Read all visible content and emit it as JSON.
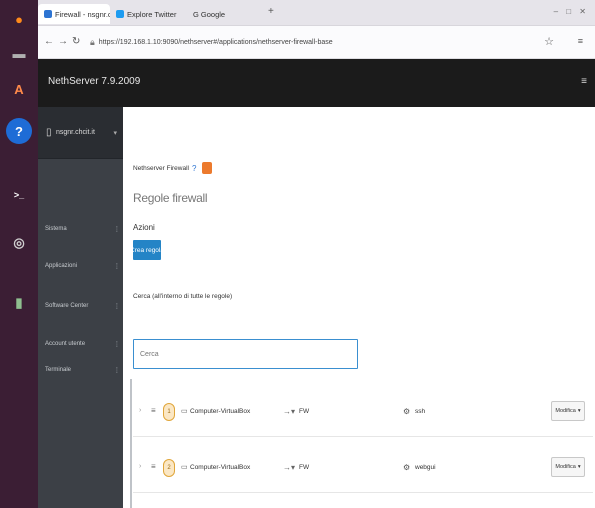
{
  "dock": {
    "items": [
      {
        "name": "firefox-icon",
        "glyph": "●",
        "color": "#e66000"
      },
      {
        "name": "files-icon",
        "glyph": "▬",
        "color": "#8a8a8a"
      },
      {
        "name": "software-icon",
        "glyph": "A",
        "color": "#e95420"
      },
      {
        "name": "help-icon",
        "glyph": "?",
        "color": "#1e6cd6"
      },
      {
        "name": "terminal-icon",
        "glyph": ">_",
        "color": "#333333"
      },
      {
        "name": "disc-icon",
        "glyph": "◎",
        "color": "#777777"
      },
      {
        "name": "trash-icon",
        "glyph": "▮",
        "color": "#5a8a5a"
      }
    ]
  },
  "browser": {
    "tabs": [
      {
        "label": "Firewall - nsgnr.chcit",
        "active": true
      },
      {
        "label": "Explore Twitter",
        "active": false
      },
      {
        "label": "G Google",
        "active": false
      }
    ],
    "new_tab": "+",
    "window_controls": "‒ □ ✕",
    "nav": {
      "back": "←",
      "forward": "→",
      "reload": "↻"
    },
    "url": "https://192.168.1.10:9090/nethserver#/applications/nethserver-firewall-base",
    "bookmark": "☆",
    "menu": "≡"
  },
  "app": {
    "title": "NethServer 7.9.2009",
    "header_icon": "≡"
  },
  "sidebar": {
    "host_label": "nsgnr.chcit.it",
    "items": [
      {
        "label": "Sistema"
      },
      {
        "label": "Applicazioni"
      },
      {
        "label": "Software Center"
      },
      {
        "label": "Account utente"
      },
      {
        "label": "Terminale"
      }
    ]
  },
  "main": {
    "breadcrumb": "Nethserver Firewall",
    "page_title": "Regole firewall",
    "section_label": "Azioni",
    "create_button": "Crea regola",
    "filter_label": "Cerca (all'interno di tutte le regole)",
    "filter_placeholder": "Cerca",
    "rules": [
      {
        "order": "1",
        "source": "Computer-VirtualBox",
        "destination": "FW",
        "service": "ssh",
        "action": "Modifica"
      },
      {
        "order": "2",
        "source": "Computer-VirtualBox",
        "destination": "FW",
        "service": "webgui",
        "action": "Modifica"
      }
    ]
  }
}
